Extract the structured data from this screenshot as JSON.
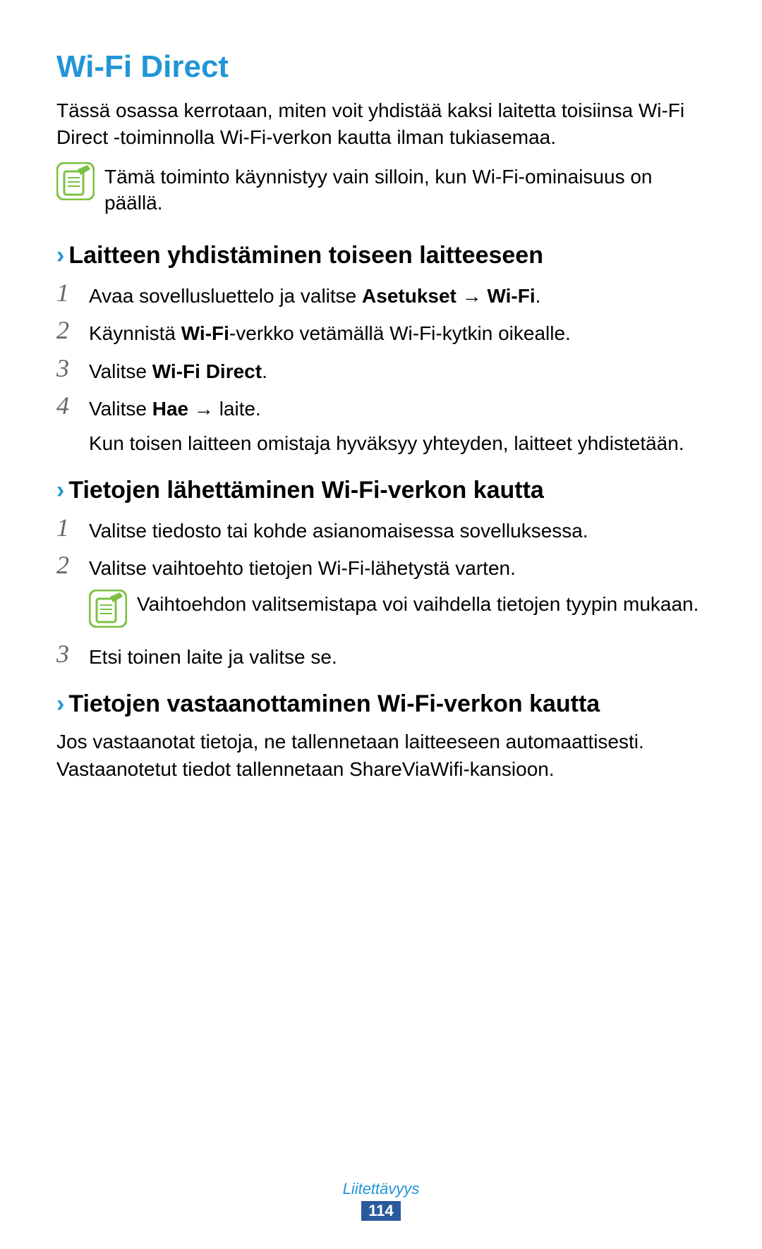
{
  "title": "Wi-Fi Direct",
  "intro": "Tässä osassa kerrotaan, miten voit yhdistää kaksi laitetta toisiinsa Wi-Fi Direct -toiminnolla Wi-Fi-verkon kautta ilman tukiasemaa.",
  "note1": "Tämä toiminto käynnistyy vain silloin, kun Wi-Fi-ominaisuus on päällä.",
  "section1": {
    "title": "Laitteen yhdistäminen toiseen laitteeseen",
    "steps": {
      "s1_pre": "Avaa sovellusluettelo ja valitse ",
      "s1_b1": "Asetukset",
      "s1_arrow": " → ",
      "s1_b2": "Wi-Fi",
      "s1_post": ".",
      "s2_pre": "Käynnistä ",
      "s2_b": "Wi-Fi",
      "s2_post": "-verkko vetämällä Wi-Fi-kytkin oikealle.",
      "s3_pre": "Valitse ",
      "s3_b": "Wi-Fi Direct",
      "s3_post": ".",
      "s4_pre": "Valitse ",
      "s4_b": "Hae",
      "s4_arrow": " → ",
      "s4_post": "laite.",
      "s4_sub": "Kun toisen laitteen omistaja hyväksyy yhteyden, laitteet yhdistetään."
    }
  },
  "section2": {
    "title": "Tietojen lähettäminen Wi-Fi-verkon kautta",
    "steps": {
      "s1": "Valitse tiedosto tai kohde asianomaisessa sovelluksessa.",
      "s2": "Valitse vaihtoehto tietojen Wi-Fi-lähetystä varten.",
      "note": "Vaihtoehdon valitsemistapa voi vaihdella tietojen tyypin mukaan.",
      "s3": "Etsi toinen laite ja valitse se."
    }
  },
  "section3": {
    "title": "Tietojen vastaanottaminen Wi-Fi-verkon kautta",
    "body": "Jos vastaanotat tietoja, ne tallennetaan laitteeseen automaattisesti. Vastaanotetut tiedot tallennetaan ShareViaWifi-kansioon."
  },
  "numbers": {
    "n1": "1",
    "n2": "2",
    "n3": "3",
    "n4": "4"
  },
  "chevron": "›",
  "footer": {
    "label": "Liitettävyys",
    "page": "114"
  },
  "icon_name": "note-icon"
}
